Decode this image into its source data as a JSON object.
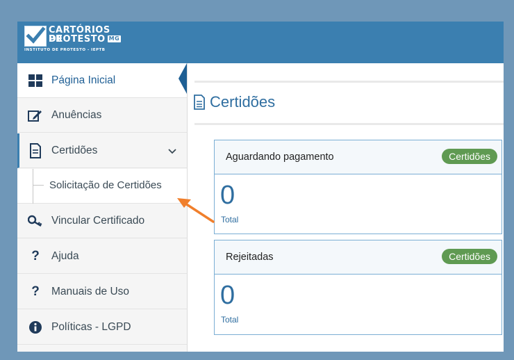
{
  "header": {
    "brand_line1": "CARTÓRIOS DE",
    "brand_line2": "PROTESTO",
    "brand_badge": "MG",
    "brand_tagline": "INSTITUTO DE PROTESTO - IEPTB"
  },
  "sidebar": {
    "items": [
      {
        "label": "Página Inicial",
        "icon": "grid-icon"
      },
      {
        "label": "Anuências",
        "icon": "edit-icon"
      },
      {
        "label": "Certidões",
        "icon": "document-icon"
      },
      {
        "label": "Solicitação de Certidões",
        "icon": ""
      },
      {
        "label": "Vincular Certificado",
        "icon": "key-icon"
      },
      {
        "label": "Ajuda",
        "icon": "question-icon"
      },
      {
        "label": "Manuais de Uso",
        "icon": "question-icon"
      },
      {
        "label": "Políticas - LGPD",
        "icon": "info-icon"
      }
    ]
  },
  "main": {
    "title": "Certidões",
    "cards": [
      {
        "label": "Aguardando pagamento",
        "badge": "Certidões",
        "value": "0",
        "caption": "Total"
      },
      {
        "label": "Rejeitadas",
        "badge": "Certidões",
        "value": "0",
        "caption": "Total"
      }
    ]
  },
  "colors": {
    "frame": "#6f97b8",
    "header": "#3b7fb0",
    "accent": "#2f6ea0",
    "badge": "#5f9a52",
    "arrow": "#f07f2c"
  }
}
